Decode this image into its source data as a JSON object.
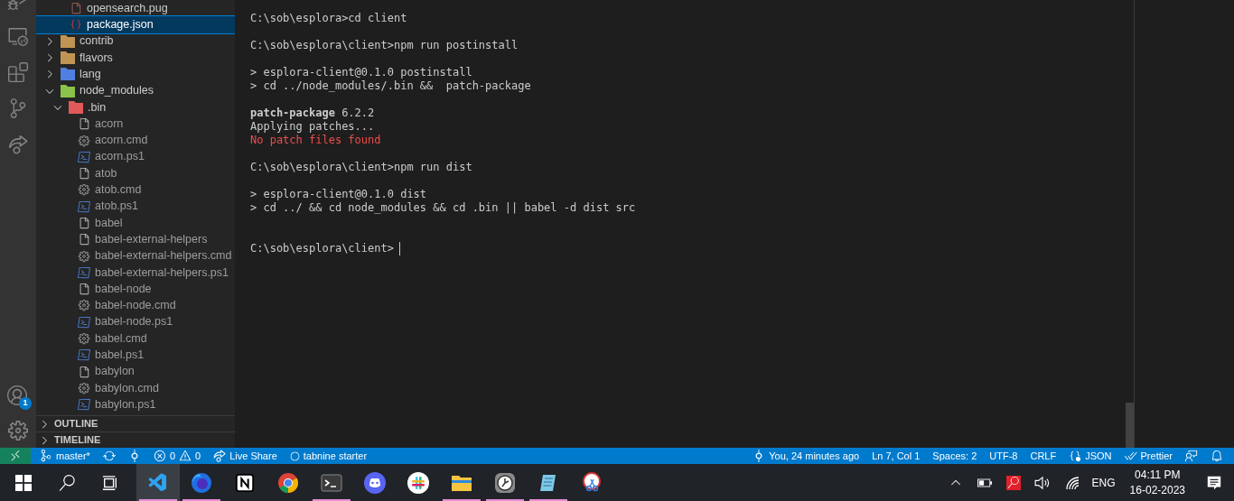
{
  "activity_bar": {
    "items": [
      {
        "kind": "debug",
        "selected": false
      },
      {
        "kind": "remote",
        "selected": false
      },
      {
        "kind": "extensions",
        "selected": false
      },
      {
        "kind": "git",
        "selected": false
      },
      {
        "kind": "liveshare",
        "selected": false
      }
    ],
    "account_badge": "1"
  },
  "explorer": {
    "tree": [
      {
        "children": [
          {
            "name": "opensearch.pug",
            "kind": "pug",
            "selected": false
          },
          {
            "name": "package.json",
            "kind": "json",
            "selected": true
          }
        ]
      },
      {
        "name": "contrib",
        "kind": "folder",
        "color": "#c09553",
        "expanded": false,
        "selected": false
      },
      {
        "name": "flavors",
        "kind": "folder",
        "color": "#c09553",
        "expanded": false,
        "selected": false
      },
      {
        "name": "lang",
        "kind": "folder",
        "color": "#4f7fe0",
        "expanded": false,
        "selected": false
      },
      {
        "name": "node_modules",
        "kind": "folder",
        "color": "#8bc34a",
        "expanded": true,
        "selected": false,
        "children": [
          {
            "name": ".bin",
            "kind": "folder",
            "color": "#e05a5a",
            "expanded": true,
            "selected": false,
            "children": [
              {
                "name": "acorn",
                "kind": "file",
                "selected": false
              },
              {
                "name": "acorn.cmd",
                "kind": "cmd",
                "selected": false
              },
              {
                "name": "acorn.ps1",
                "kind": "ps1",
                "selected": false
              },
              {
                "name": "atob",
                "kind": "file",
                "selected": false
              },
              {
                "name": "atob.cmd",
                "kind": "cmd",
                "selected": false
              },
              {
                "name": "atob.ps1",
                "kind": "ps1",
                "selected": false
              },
              {
                "name": "babel",
                "kind": "file",
                "selected": false
              },
              {
                "name": "babel-external-helpers",
                "kind": "file",
                "selected": false
              },
              {
                "name": "babel-external-helpers.cmd",
                "kind": "cmd",
                "selected": false
              },
              {
                "name": "babel-external-helpers.ps1",
                "kind": "ps1",
                "selected": false
              },
              {
                "name": "babel-node",
                "kind": "file",
                "selected": false
              },
              {
                "name": "babel-node.cmd",
                "kind": "cmd",
                "selected": false
              },
              {
                "name": "babel-node.ps1",
                "kind": "ps1",
                "selected": false
              },
              {
                "name": "babel.cmd",
                "kind": "cmd",
                "selected": false
              },
              {
                "name": "babel.ps1",
                "kind": "ps1",
                "selected": false
              },
              {
                "name": "babylon",
                "kind": "file",
                "selected": false
              },
              {
                "name": "babylon.cmd",
                "kind": "cmd",
                "selected": false
              },
              {
                "name": "babylon.ps1",
                "kind": "ps1",
                "selected": false
              }
            ]
          }
        ]
      }
    ],
    "sections": [
      {
        "title": "OUTLINE",
        "expanded": false
      },
      {
        "title": "TIMELINE",
        "expanded": false
      }
    ]
  },
  "terminal": {
    "blocks": [
      {
        "kind": "output",
        "lines": [
          {
            "kind": "normal",
            "text": "C:\\sob\\esplora>cd client"
          }
        ]
      },
      {
        "kind": "output",
        "lines": [
          {
            "kind": "normal",
            "text": "C:\\sob\\esplora\\client>npm run postinstall"
          }
        ]
      },
      {
        "kind": "output",
        "lines": [
          {
            "kind": "normal",
            "text": "> esplora-client@0.1.0 postinstall"
          },
          {
            "kind": "normal",
            "text": "> cd ../node_modules/.bin &&  patch-package"
          }
        ]
      },
      {
        "kind": "output",
        "lines": [
          {
            "kind": "normal",
            "text": "**patch-package** 6.2.2"
          },
          {
            "kind": "normal",
            "text": "Applying patches..."
          },
          {
            "kind": "error",
            "text": "No patch files found"
          }
        ]
      },
      {
        "kind": "output",
        "lines": [
          {
            "kind": "normal",
            "text": "C:\\sob\\esplora\\client>npm run dist"
          }
        ]
      },
      {
        "kind": "output",
        "lines": [
          {
            "kind": "normal",
            "text": "> esplora-client@0.1.0 dist"
          },
          {
            "kind": "normal",
            "text": "> cd ../ && cd node_modules && cd .bin || babel -d dist src"
          }
        ]
      },
      {
        "kind": "prompt",
        "lines": [
          {
            "kind": "normal",
            "text": "C:\\sob\\esplora\\client>"
          }
        ]
      }
    ]
  },
  "status_bar": {
    "left": [
      {
        "kind": "remote"
      },
      {
        "kind": "branch",
        "text": "master*"
      },
      {
        "kind": "sync"
      },
      {
        "kind": "gitgraph"
      },
      {
        "kind": "problems",
        "errors": "0",
        "warnings": "0"
      },
      {
        "kind": "liveshare",
        "text": "Live Share"
      },
      {
        "kind": "tabnine",
        "text": "tabnine starter"
      }
    ],
    "right": [
      {
        "kind": "blame",
        "text": "You, 24 minutes ago"
      },
      {
        "kind": "plain",
        "text": "Ln 7, Col 1"
      },
      {
        "kind": "plain",
        "text": "Spaces: 2"
      },
      {
        "kind": "plain",
        "text": "UTF-8"
      },
      {
        "kind": "plain",
        "text": "CRLF"
      },
      {
        "kind": "language",
        "text": "JSON"
      },
      {
        "kind": "formatter",
        "text": "Prettier"
      },
      {
        "kind": "feedback"
      },
      {
        "kind": "bell"
      }
    ]
  },
  "taskbar": {
    "apps": [
      {
        "kind": "start",
        "running": false,
        "selected": false
      },
      {
        "kind": "search",
        "running": false,
        "selected": false
      },
      {
        "kind": "taskview",
        "running": false,
        "selected": false
      },
      {
        "kind": "vscode",
        "running": true,
        "selected": true
      },
      {
        "kind": "firefox",
        "running": true,
        "selected": false
      },
      {
        "kind": "notion",
        "running": false,
        "selected": false
      },
      {
        "kind": "chrome",
        "running": false,
        "selected": false
      },
      {
        "kind": "terminal",
        "running": true,
        "selected": false
      },
      {
        "kind": "discord",
        "running": false,
        "selected": false
      },
      {
        "kind": "slack",
        "running": false,
        "selected": false
      },
      {
        "kind": "files",
        "running": true,
        "selected": false
      },
      {
        "kind": "clock",
        "running": true,
        "selected": false
      },
      {
        "kind": "notepad",
        "running": true,
        "selected": false
      },
      {
        "kind": "snipping",
        "running": false,
        "selected": false
      }
    ],
    "tray": {
      "language": "ENG",
      "time": "04:11 PM",
      "date": "16-02-2023"
    }
  }
}
